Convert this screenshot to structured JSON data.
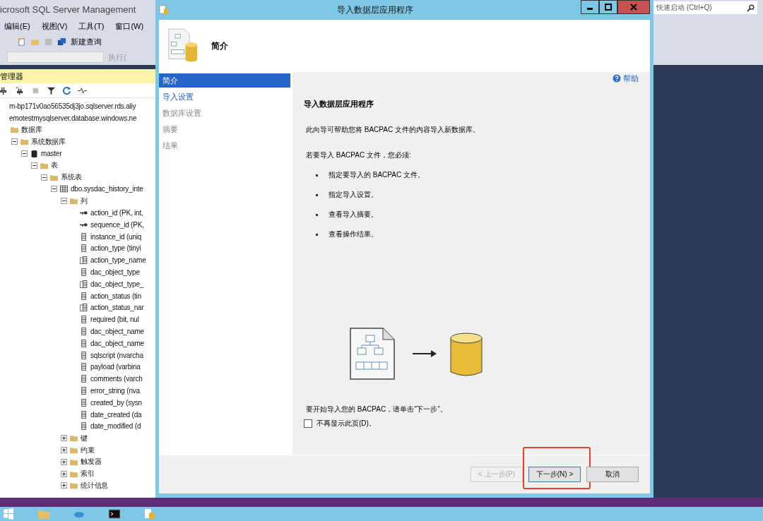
{
  "ssms": {
    "title": "icrosoft SQL Server Management",
    "menu": [
      "编辑(E)",
      "视图(V)",
      "工具(T)",
      "窗口(W)"
    ],
    "toolbar": {
      "new_query": "新建查询",
      "execute": "执行("
    },
    "explorer_title": "管理器",
    "tree": [
      {
        "label": "m-bp171v0ao56535dj3jo.sqlserver.rds.aliy"
      },
      {
        "label": "emotestmysqlserver.database.windows.ne",
        "children": [
          {
            "label": "数据库",
            "kind": "folder",
            "children": [
              {
                "label": "系统数据库",
                "kind": "folder",
                "expanded": true,
                "children": [
                  {
                    "label": "master",
                    "kind": "database",
                    "expanded": true,
                    "children": [
                      {
                        "label": "表",
                        "kind": "folder",
                        "expanded": true,
                        "children": [
                          {
                            "label": "系统表",
                            "kind": "folder",
                            "expanded": true,
                            "children": [
                              {
                                "label": "dbo.sysdac_history_inte",
                                "kind": "table",
                                "expanded": true,
                                "children": [
                                  {
                                    "label": "列",
                                    "kind": "folder",
                                    "expanded": true,
                                    "children": [
                                      {
                                        "label": "action_id (PK, int,",
                                        "kind": "key"
                                      },
                                      {
                                        "label": "sequence_id (PK,",
                                        "kind": "key"
                                      },
                                      {
                                        "label": "instance_id (uniq",
                                        "kind": "column"
                                      },
                                      {
                                        "label": "action_type (tinyi",
                                        "kind": "column"
                                      },
                                      {
                                        "label": "action_type_name",
                                        "kind": "computed"
                                      },
                                      {
                                        "label": "dac_object_type",
                                        "kind": "column"
                                      },
                                      {
                                        "label": "dac_object_type_",
                                        "kind": "computed"
                                      },
                                      {
                                        "label": "action_status (tin",
                                        "kind": "column"
                                      },
                                      {
                                        "label": "action_status_nar",
                                        "kind": "computed"
                                      },
                                      {
                                        "label": "required (bit, nul",
                                        "kind": "column"
                                      },
                                      {
                                        "label": "dac_object_name",
                                        "kind": "column"
                                      },
                                      {
                                        "label": "dac_object_name",
                                        "kind": "column"
                                      },
                                      {
                                        "label": "sqlscript (nvarcha",
                                        "kind": "column"
                                      },
                                      {
                                        "label": "payload (varbina",
                                        "kind": "column"
                                      },
                                      {
                                        "label": "comments (varch",
                                        "kind": "column"
                                      },
                                      {
                                        "label": "error_string (nva",
                                        "kind": "column"
                                      },
                                      {
                                        "label": "created_by (sysn",
                                        "kind": "column"
                                      },
                                      {
                                        "label": "date_created (da",
                                        "kind": "column"
                                      },
                                      {
                                        "label": "date_modified (d",
                                        "kind": "column"
                                      }
                                    ]
                                  },
                                  {
                                    "label": "键",
                                    "kind": "folder",
                                    "expanded": false
                                  },
                                  {
                                    "label": "约束",
                                    "kind": "folder",
                                    "expanded": false
                                  },
                                  {
                                    "label": "触发器",
                                    "kind": "folder",
                                    "expanded": false
                                  },
                                  {
                                    "label": "索引",
                                    "kind": "folder",
                                    "expanded": false
                                  },
                                  {
                                    "label": "统计信息",
                                    "kind": "folder",
                                    "expanded": false
                                  }
                                ]
                              }
                            ]
                          }
                        ]
                      }
                    ]
                  }
                ]
              }
            ]
          }
        ]
      }
    ]
  },
  "dialog": {
    "title": "导入数据层应用程序",
    "header": "简介",
    "nav": [
      {
        "label": "简介",
        "selected": true,
        "enabled": true
      },
      {
        "label": "导入设置",
        "selected": false,
        "enabled": true
      },
      {
        "label": "数据库设置",
        "selected": false,
        "enabled": false
      },
      {
        "label": "摘要",
        "selected": false,
        "enabled": false
      },
      {
        "label": "结果",
        "selected": false,
        "enabled": false
      }
    ],
    "help": "帮助",
    "heading": "导入数据层应用程序",
    "intro": "此向导可帮助您将 BACPAC 文件的内容导入新数据库。",
    "requirements_intro": "若要导入 BACPAC 文件，您必须:",
    "steps": [
      "指定要导入的 BACPAC 文件。",
      "指定导入设置。",
      "查看导入摘要。",
      "查看操作结果。"
    ],
    "start_hint": "要开始导入您的 BACPAC，请单击“下一步”。",
    "dont_show": {
      "label": "不再显示此页(D)。",
      "checked": false
    },
    "buttons": [
      {
        "label": "< 上一步(P)",
        "disabled": true,
        "highlighted": false
      },
      {
        "label": "下一步(N) >",
        "disabled": false,
        "highlighted": true
      },
      {
        "label": "取消",
        "disabled": false,
        "highlighted": false
      }
    ]
  },
  "quick_launch": {
    "placeholder": "快速启动 (Ctrl+Q)"
  }
}
